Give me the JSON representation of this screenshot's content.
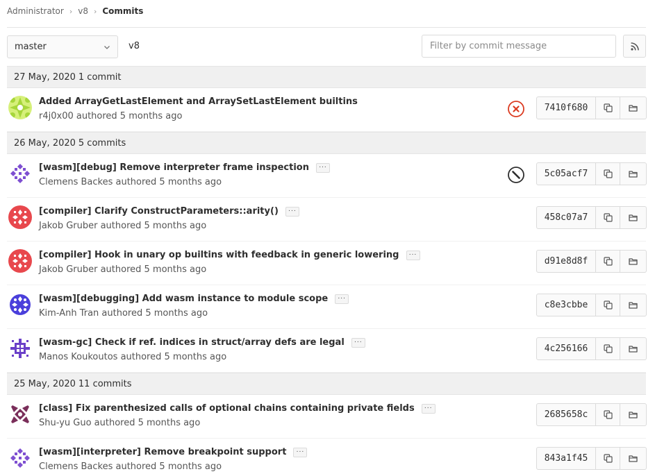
{
  "breadcrumb": {
    "owner": "Administrator",
    "project": "v8",
    "current": "Commits"
  },
  "toolbar": {
    "branch": "master",
    "project_label": "v8",
    "filter_placeholder": "Filter by commit message"
  },
  "colors": {
    "failed": "#db3b21",
    "canceled": "#2e2e2e",
    "border": "#dbdbdb"
  },
  "days": [
    {
      "date": "27 May, 2020",
      "count": "1 commit",
      "commits": [
        {
          "title": "Added ArrayGetLastElement and ArraySetLastElement builtins",
          "author": "r4j0x00",
          "meta": "r4j0x00 authored 5 months ago",
          "sha": "7410f680",
          "status": "failed",
          "has_ellipsis": false,
          "avatar": "lime-star"
        }
      ]
    },
    {
      "date": "26 May, 2020",
      "count": "5 commits",
      "commits": [
        {
          "title": "[wasm][debug] Remove interpreter frame inspection",
          "author": "Clemens Backes",
          "meta": "Clemens Backes authored 5 months ago",
          "sha": "5c05acf7",
          "status": "canceled",
          "has_ellipsis": true,
          "avatar": "purple-pattern"
        },
        {
          "title": "[compiler] Clarify ConstructParameters::arity()",
          "author": "Jakob Gruber",
          "meta": "Jakob Gruber authored 5 months ago",
          "sha": "458c07a7",
          "status": "",
          "has_ellipsis": true,
          "avatar": "red-pattern"
        },
        {
          "title": "[compiler] Hook in unary op builtins with feedback in generic lowering",
          "author": "Jakob Gruber",
          "meta": "Jakob Gruber authored 5 months ago",
          "sha": "d91e8d8f",
          "status": "",
          "has_ellipsis": true,
          "avatar": "red-pattern"
        },
        {
          "title": "[wasm][debugging] Add wasm instance to module scope",
          "author": "Kim-Anh Tran",
          "meta": "Kim-Anh Tran authored 5 months ago",
          "sha": "c8e3cbbe",
          "status": "",
          "has_ellipsis": true,
          "avatar": "blue-pattern"
        },
        {
          "title": "[wasm-gc] Check if ref. indices in struct/array defs are legal",
          "author": "Manos Koukoutos",
          "meta": "Manos Koukoutos authored 5 months ago",
          "sha": "4c256166",
          "status": "",
          "has_ellipsis": true,
          "avatar": "violet-pattern"
        }
      ]
    },
    {
      "date": "25 May, 2020",
      "count": "11 commits",
      "commits": [
        {
          "title": "[class] Fix parenthesized calls of optional chains containing private fields",
          "author": "Shu-yu Guo",
          "meta": "Shu-yu Guo authored 5 months ago",
          "sha": "2685658c",
          "status": "",
          "has_ellipsis": true,
          "avatar": "plum-pattern"
        },
        {
          "title": "[wasm][interpreter] Remove breakpoint support",
          "author": "Clemens Backes",
          "meta": "Clemens Backes authored 5 months ago",
          "sha": "843a1f45",
          "status": "",
          "has_ellipsis": true,
          "avatar": "purple-pattern"
        }
      ]
    }
  ]
}
